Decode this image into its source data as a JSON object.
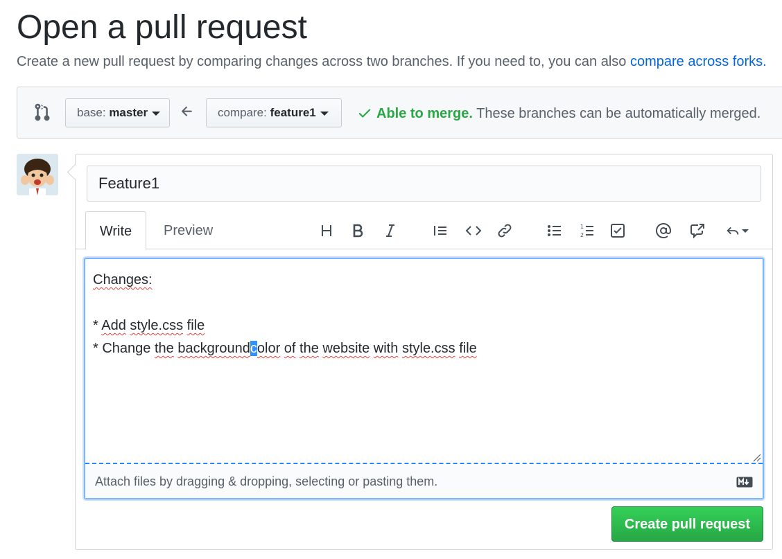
{
  "header": {
    "title": "Open a pull request",
    "subtitle": "Create a new pull request by comparing changes across two branches. If you need to, you can also ",
    "subtitle_link": "compare across forks."
  },
  "range": {
    "base_prefix": "base: ",
    "base_branch": "master",
    "compare_prefix": "compare: ",
    "compare_branch": "feature1",
    "merge_ok": "Able to merge.",
    "merge_msg": " These branches can be automatically merged."
  },
  "form": {
    "title_value": "Feature1",
    "tabs": {
      "write": "Write",
      "preview": "Preview"
    },
    "toolbar_icons": [
      "heading-icon",
      "bold-icon",
      "italic-icon",
      "quote-icon",
      "code-icon",
      "link-icon",
      "unordered-list-icon",
      "ordered-list-icon",
      "task-list-icon",
      "mention-icon",
      "reference-icon",
      "reply-icon"
    ],
    "body": {
      "line1": "Changes:",
      "line3": "* Add style.css file",
      "line4_a": "* Change the background",
      "line4_sel": "c",
      "line4_b": "olor of the website with style.css file"
    },
    "attach_text": "Attach files by dragging & dropping, selecting or pasting them.",
    "submit_label": "Create pull request"
  },
  "colors": {
    "link": "#0366d6",
    "success": "#28a745",
    "focus_border": "#79b8ff",
    "spellcheck": "#e0413a"
  }
}
